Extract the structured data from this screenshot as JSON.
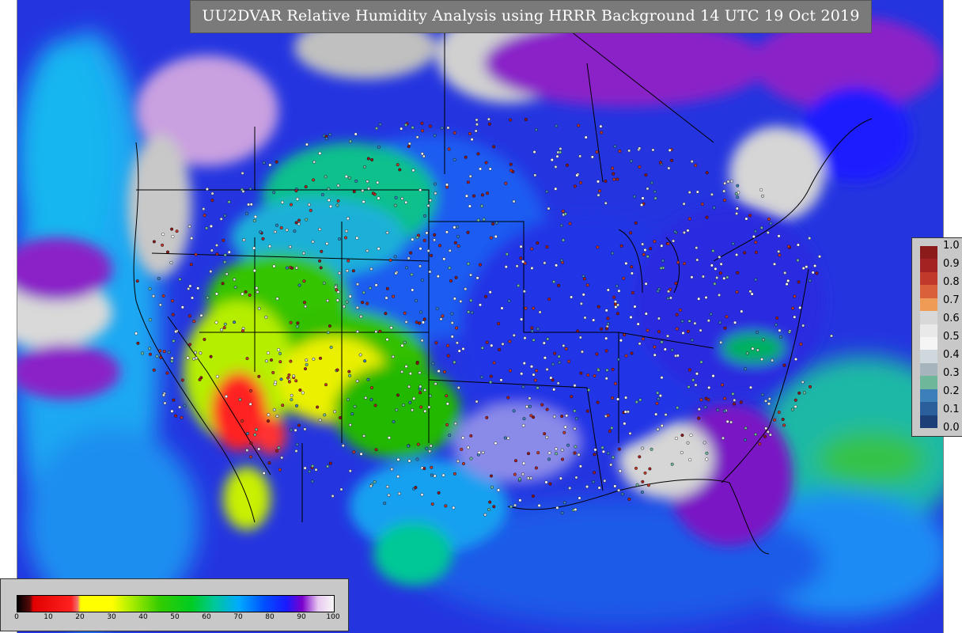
{
  "title": "UU2DVAR Relative Humidity Analysis using HRRR Background 14 UTC 19 Oct 2019",
  "station_legend": {
    "labels": [
      "1.0",
      "0.9",
      "0.8",
      "0.7",
      "0.6",
      "0.5",
      "0.4",
      "0.3",
      "0.2",
      "0.1",
      "0.0"
    ],
    "colors": [
      "#8b1a1a",
      "#a52222",
      "#c0392b",
      "#d9603b",
      "#ef9a55",
      "#d8d8d8",
      "#e9e9e9",
      "#f5f5f5",
      "#cfd8dc",
      "#a6b5bd",
      "#6fb79a",
      "#3d7fb8",
      "#2a5f9c",
      "#1c3f78"
    ]
  },
  "humidity_scale": {
    "ticks": [
      "0",
      "10",
      "20",
      "30",
      "40",
      "50",
      "60",
      "70",
      "80",
      "90",
      "100"
    ],
    "stops": [
      {
        "at": 0,
        "color": "#000000"
      },
      {
        "at": 4,
        "color": "#5a0a0a"
      },
      {
        "at": 5,
        "color": "#e00000"
      },
      {
        "at": 17,
        "color": "#ff2020"
      },
      {
        "at": 19,
        "color": "#f07070"
      },
      {
        "at": 20,
        "color": "#ffff00"
      },
      {
        "at": 30,
        "color": "#ffff00"
      },
      {
        "at": 35,
        "color": "#b8f000"
      },
      {
        "at": 45,
        "color": "#33cc00"
      },
      {
        "at": 55,
        "color": "#00cc22"
      },
      {
        "at": 62,
        "color": "#00c896"
      },
      {
        "at": 70,
        "color": "#00aaff"
      },
      {
        "at": 78,
        "color": "#0050ff"
      },
      {
        "at": 85,
        "color": "#1a1aff"
      },
      {
        "at": 90,
        "color": "#7a00cc"
      },
      {
        "at": 95,
        "color": "#e8c8f0"
      },
      {
        "at": 100,
        "color": "#f8f8f8"
      }
    ]
  }
}
